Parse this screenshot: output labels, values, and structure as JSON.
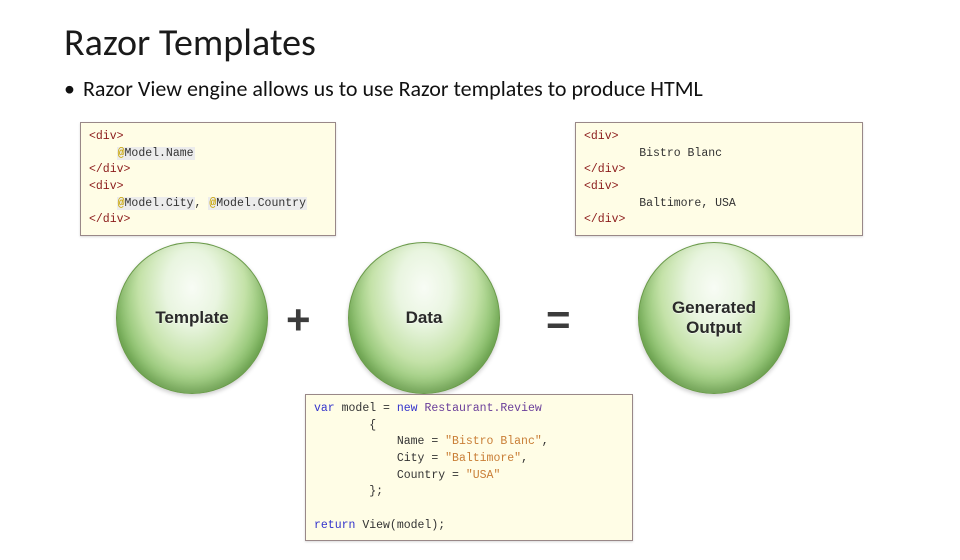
{
  "title": "Razor Templates",
  "bullet": "Razor View engine allows us to use Razor templates to produce HTML",
  "circles": {
    "template": "Template",
    "data": "Data",
    "output": "Generated\nOutput",
    "plus": "+",
    "equals": "="
  },
  "template_code": {
    "l1a": "<div>",
    "l2_at": "@",
    "l2_expr": "Model.Name",
    "l3a": "</div>",
    "l4a": "<div>",
    "l5_at1": "@",
    "l5_expr1": "Model.City",
    "l5_comma": ", ",
    "l5_at2": "@",
    "l5_expr2": "Model.Country",
    "l6a": "</div>"
  },
  "output_code": {
    "l1": "<div>",
    "l2": "Bistro Blanc",
    "l3": "</div>",
    "l4": "<div>",
    "l5": "Baltimore, USA",
    "l6": "</div>"
  },
  "data_code": {
    "l1_kw": "var",
    "l1_rest": " model = ",
    "l1_new": "new",
    "l1_sp": " ",
    "l1_type": "Restaurant.Review",
    "l2": "{",
    "l3_prop": "Name = ",
    "l3_val": "\"Bistro Blanc\"",
    "l3_c": ",",
    "l4_prop": "City = ",
    "l4_val": "\"Baltimore\"",
    "l4_c": ",",
    "l5_prop": "Country = ",
    "l5_val": "\"USA\"",
    "l6": "};",
    "blank": "",
    "l7_kw": "return",
    "l7_rest": " View(model);"
  }
}
